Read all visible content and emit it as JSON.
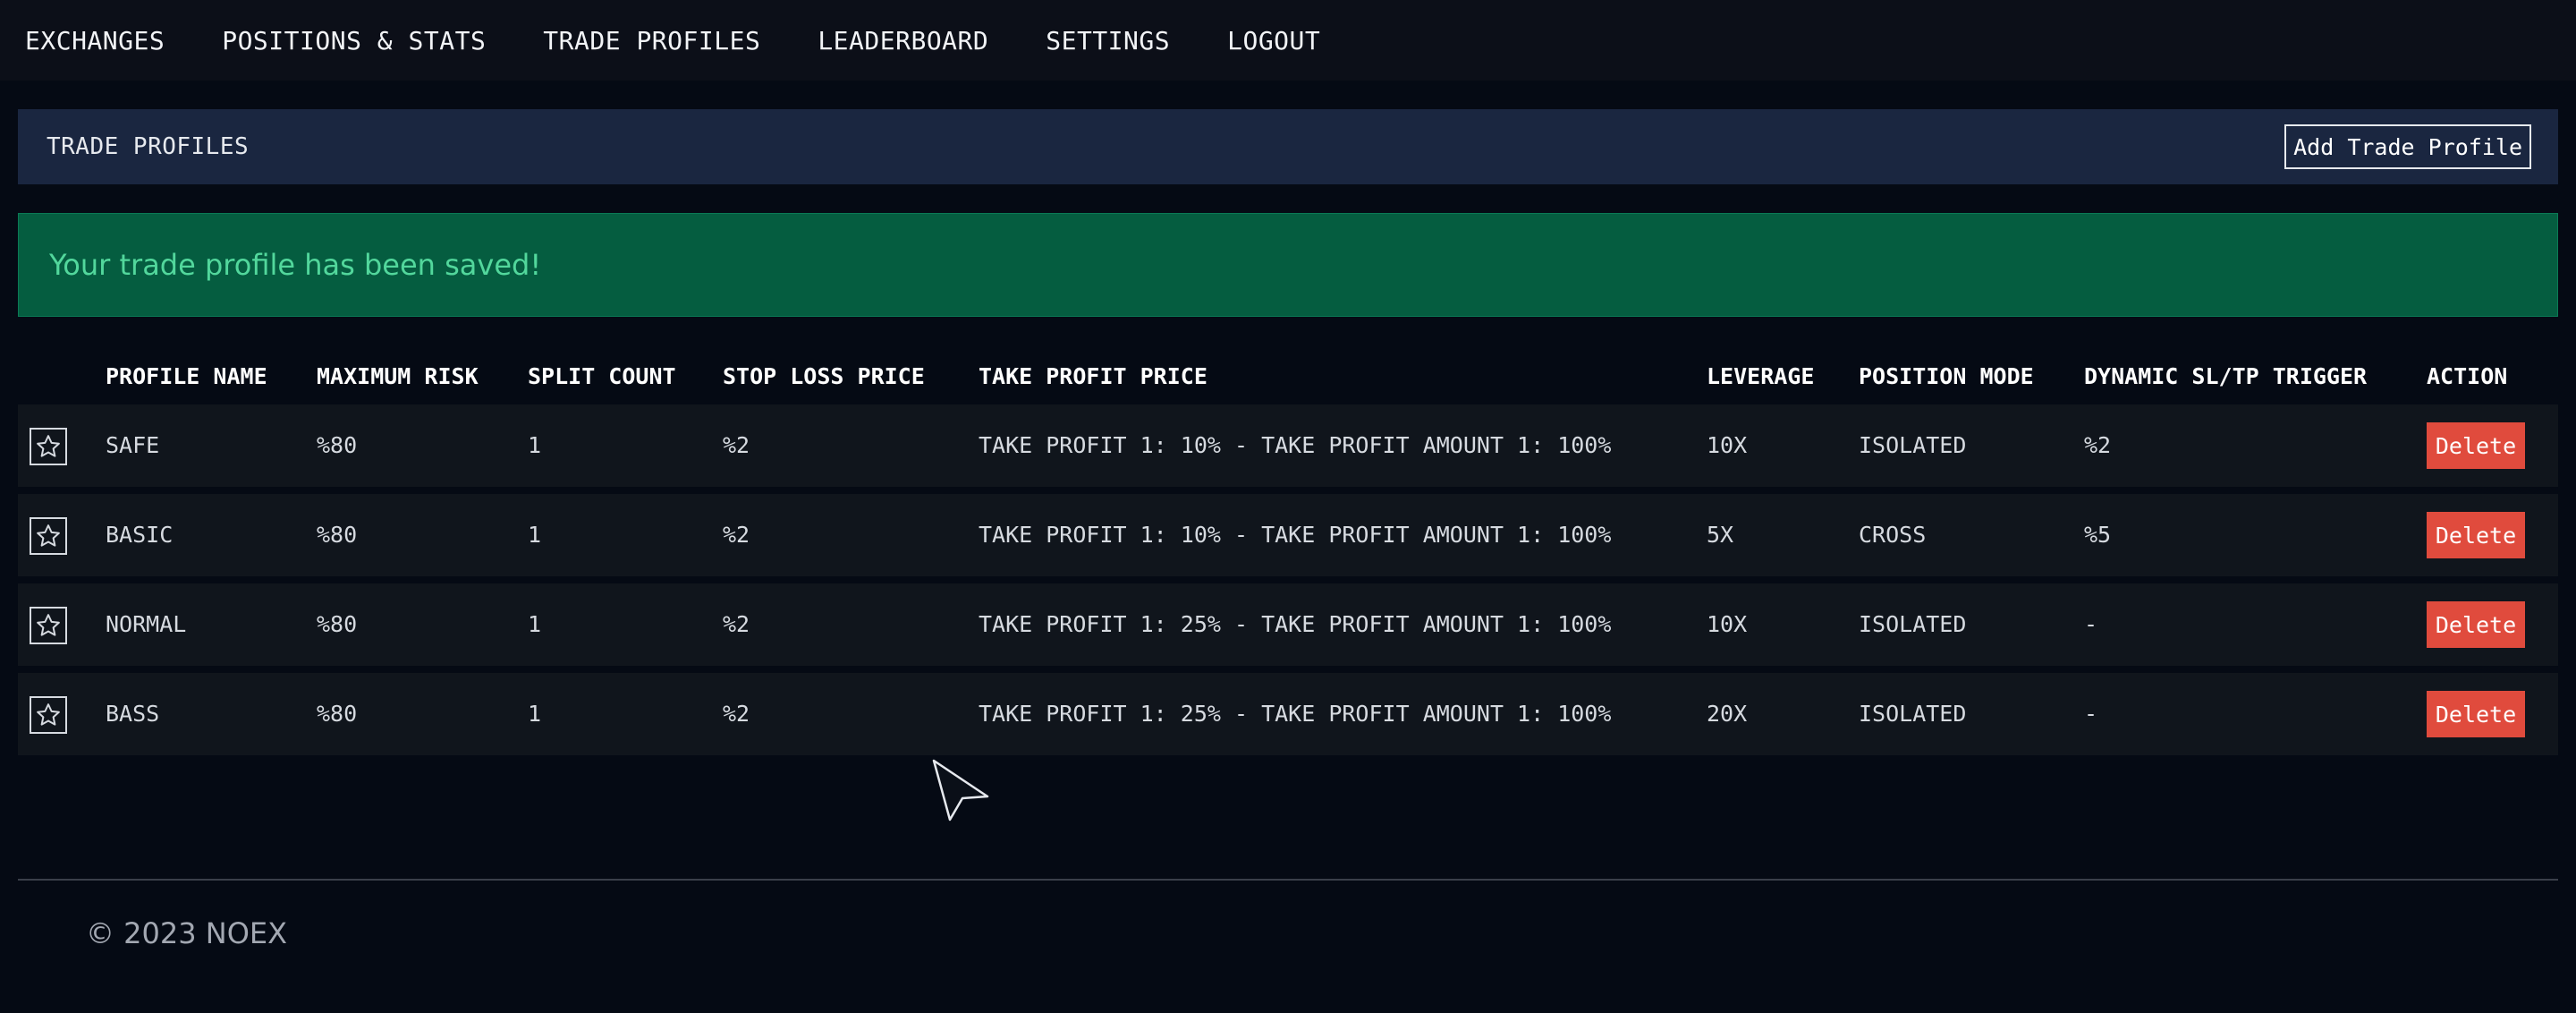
{
  "nav": {
    "items": [
      {
        "label": "EXCHANGES"
      },
      {
        "label": "POSITIONS & STATS"
      },
      {
        "label": "TRADE PROFILES"
      },
      {
        "label": "LEADERBOARD"
      },
      {
        "label": "SETTINGS"
      },
      {
        "label": "LOGOUT"
      }
    ]
  },
  "header": {
    "title": "TRADE PROFILES",
    "add_button": "Add Trade Profile"
  },
  "alert": {
    "message": "Your trade profile has been saved!",
    "color": "#055d40"
  },
  "table": {
    "columns": {
      "name": "PROFILE NAME",
      "risk": "MAXIMUM RISK",
      "split": "SPLIT COUNT",
      "sl": "STOP LOSS PRICE",
      "tp": "TAKE PROFIT PRICE",
      "leverage": "LEVERAGE",
      "mode": "POSITION MODE",
      "dynamic": "DYNAMIC SL/TP TRIGGER",
      "action": "ACTION"
    },
    "rows": [
      {
        "name": "SAFE",
        "risk": "%80",
        "split": "1",
        "sl": "%2",
        "tp": "TAKE PROFIT 1: 10% - TAKE PROFIT AMOUNT 1: 100%",
        "leverage": "10X",
        "mode": "ISOLATED",
        "dynamic": "%2",
        "action": "Delete",
        "icon": "star-icon"
      },
      {
        "name": "BASIC",
        "risk": "%80",
        "split": "1",
        "sl": "%2",
        "tp": "TAKE PROFIT 1: 10% - TAKE PROFIT AMOUNT 1: 100%",
        "leverage": "5X",
        "mode": "CROSS",
        "dynamic": "%5",
        "action": "Delete",
        "icon": "star-icon"
      },
      {
        "name": "NORMAL",
        "risk": "%80",
        "split": "1",
        "sl": "%2",
        "tp": "TAKE PROFIT 1: 25% - TAKE PROFIT AMOUNT 1: 100%",
        "leverage": "10X",
        "mode": "ISOLATED",
        "dynamic": "-",
        "action": "Delete",
        "icon": "star-icon"
      },
      {
        "name": "BASS",
        "risk": "%80",
        "split": "1",
        "sl": "%2",
        "tp": "TAKE PROFIT 1: 25% - TAKE PROFIT AMOUNT 1: 100%",
        "leverage": "20X",
        "mode": "ISOLATED",
        "dynamic": "-",
        "action": "Delete",
        "icon": "star-icon"
      }
    ],
    "delete_color": "#e04b3d"
  },
  "footer": {
    "copyright": "© 2023 NOEX"
  }
}
